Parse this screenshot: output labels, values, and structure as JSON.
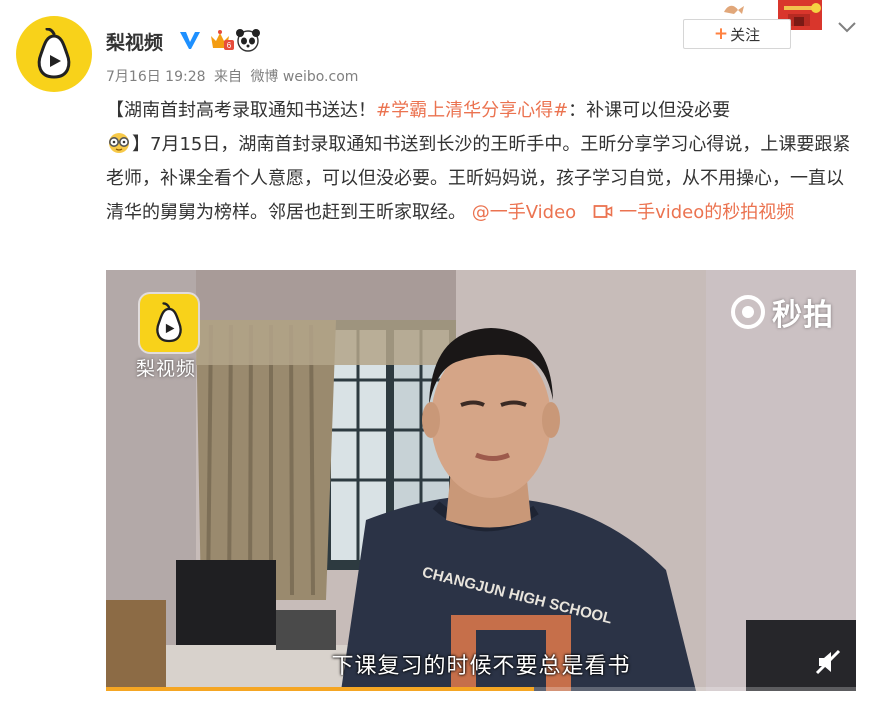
{
  "account": {
    "name": "梨视频",
    "verified_icon": "verified-v-icon",
    "badges": [
      "vip-crown-badge",
      "panda-badge"
    ]
  },
  "post_meta": {
    "date": "7月16日 19:28",
    "from_label": "来自",
    "source": "微博 weibo.com"
  },
  "actions": {
    "follow_label": "关注",
    "follow_plus": "+"
  },
  "post": {
    "lead_open": "【湖南首封高考录取通知书送达！",
    "hashtag": "#学霸上清华分享心得#",
    "lead_after_tag": "：补课可以但没必要",
    "emoji": "nerd-glasses-emoji",
    "body": "】7月15日，湖南首封录取通知书送到长沙的王昕手中。王昕分享学习心得说，上课要跟紧老师，补课全看个人意愿，可以但没必要。王昕妈妈说，孩子学习自觉，从不用操心，一直以清华的舅舅为榜样。邻居也赶到王昕家取经。",
    "mention": "@一手Video",
    "video_link_label": "一手video的秒拍视频"
  },
  "video": {
    "logo_label": "梨视频",
    "watermark": "秒拍",
    "subtitle": "下课复习的时候不要总是看书",
    "shirt_text": "CHANGJUN HIGH SCHOOL",
    "progress": 0.57
  },
  "colors": {
    "brand_yellow": "#f8d21a",
    "link_orange": "#eb7350",
    "progress": "#f5a623"
  }
}
